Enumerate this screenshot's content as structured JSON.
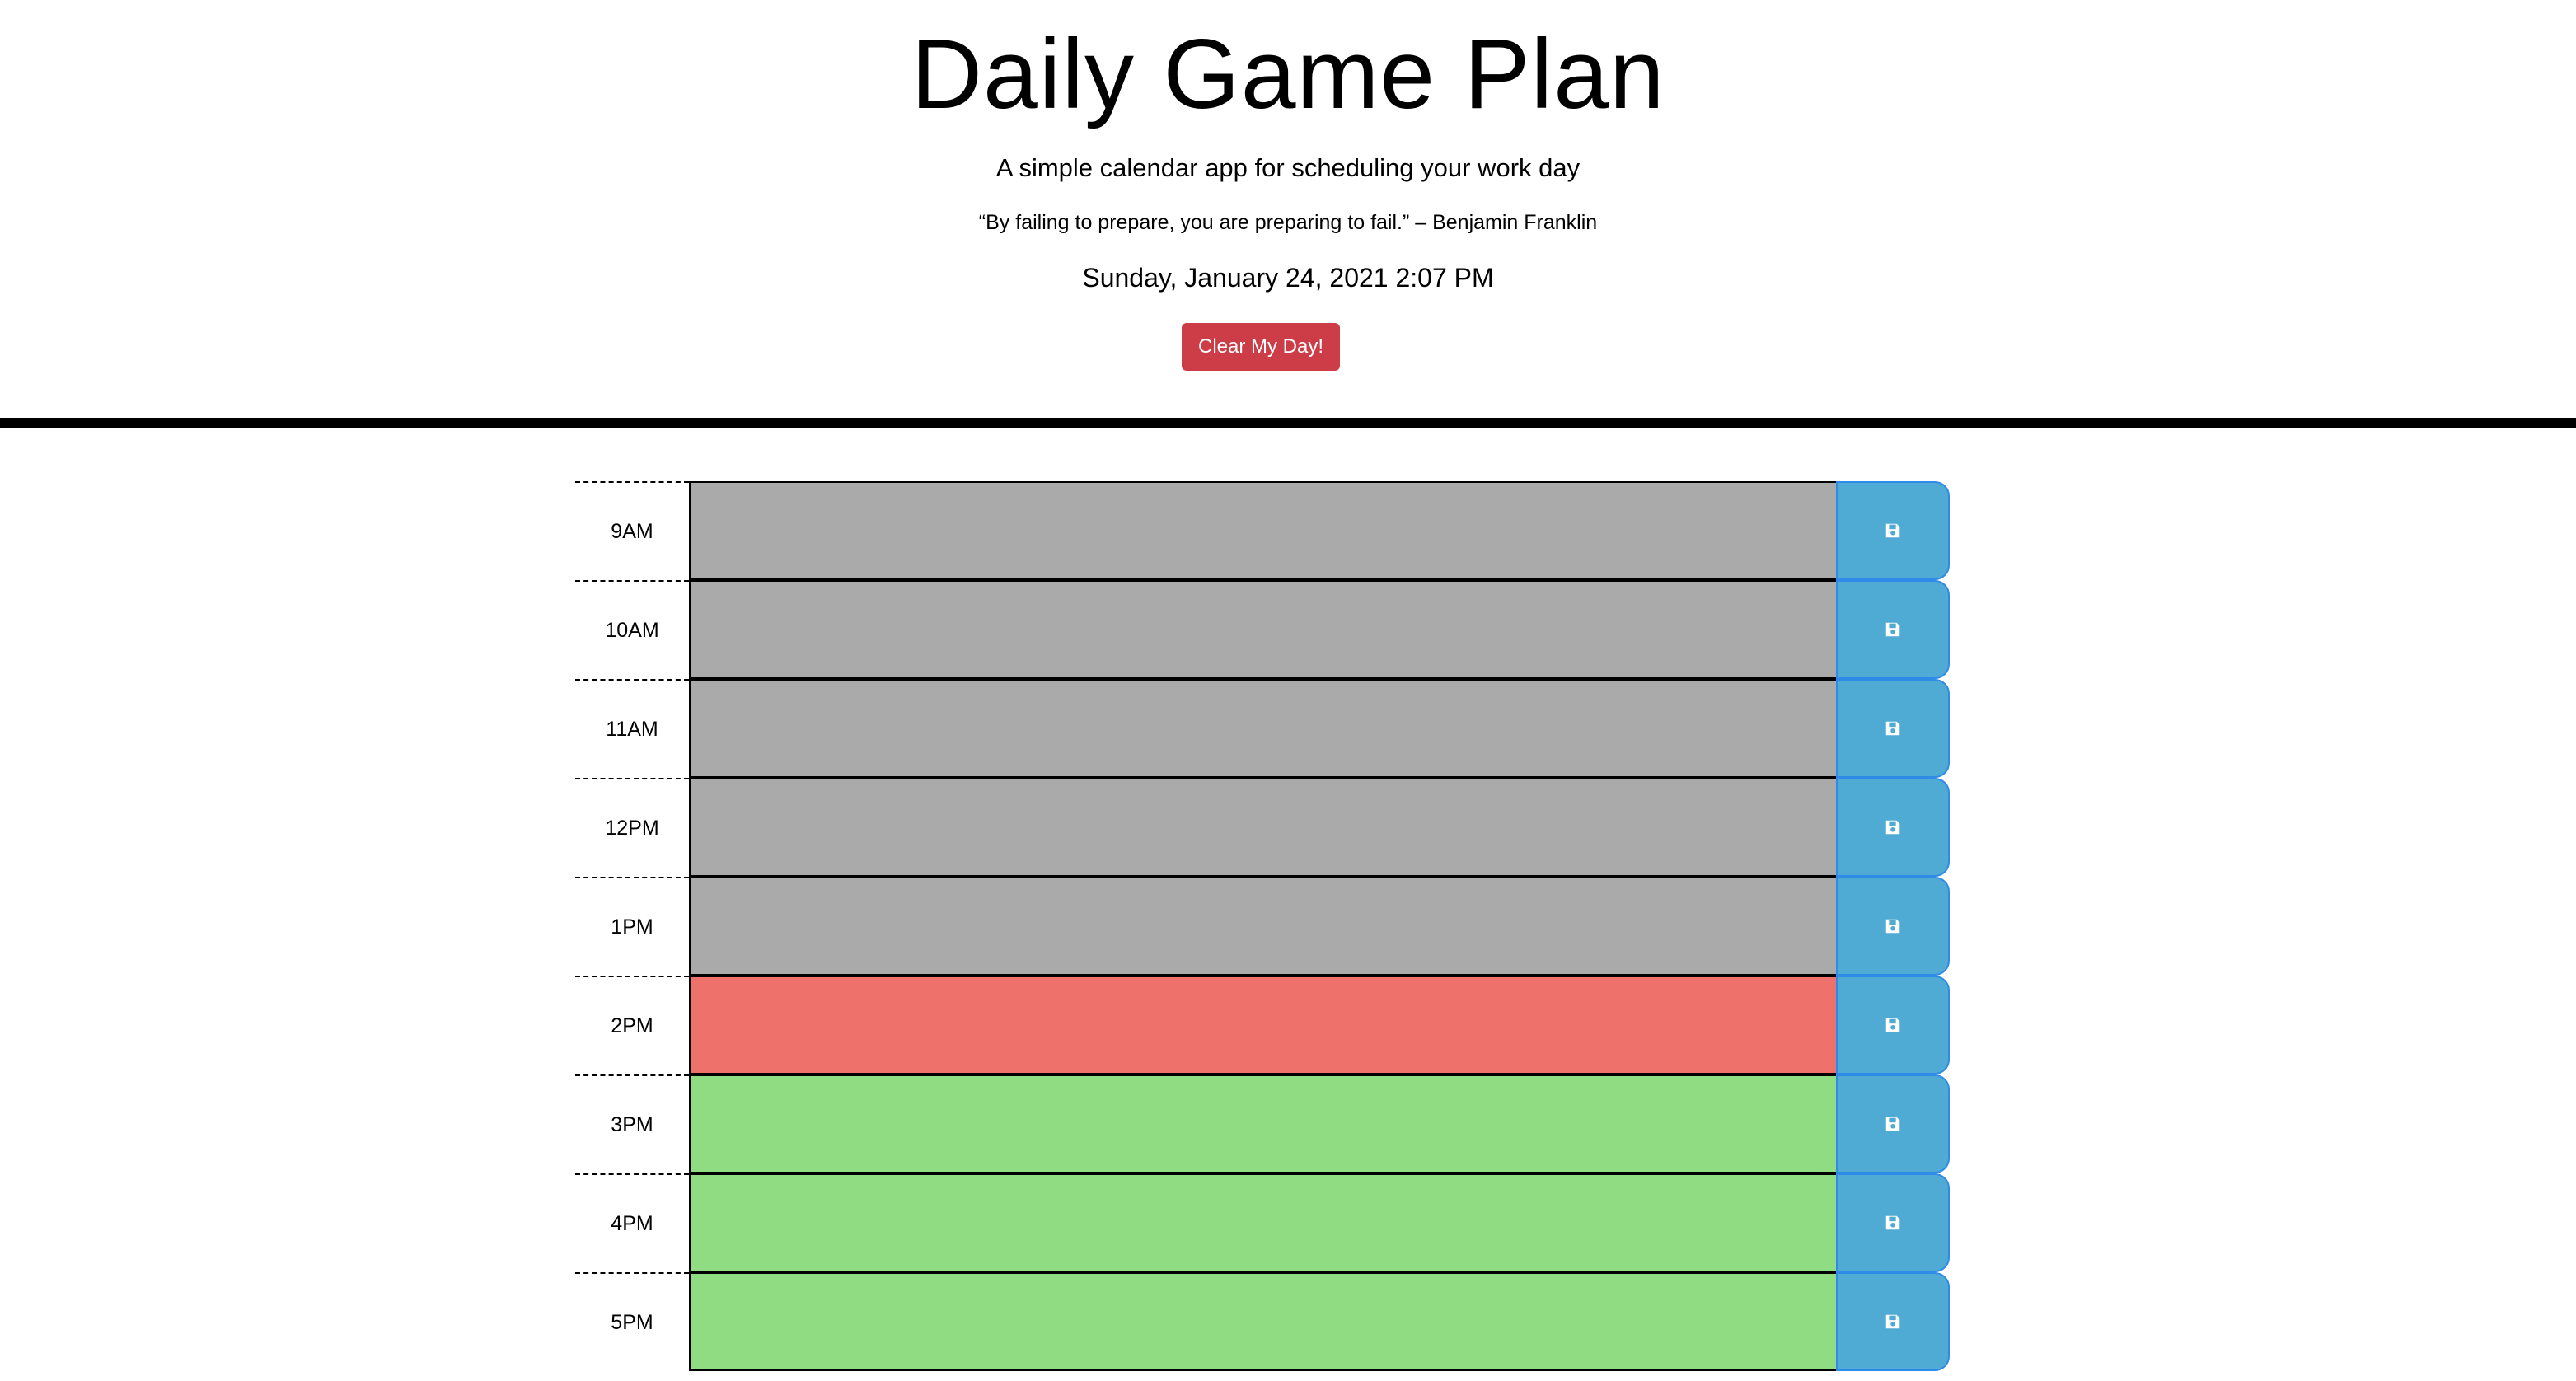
{
  "header": {
    "title": "Daily Game Plan",
    "subtitle": "A simple calendar app for scheduling your work day",
    "quote": "“By failing to prepare, you are preparing to fail.” – Benjamin Franklin",
    "datetime": "Sunday, January 24, 2021 2:07 PM",
    "clear_label": "Clear My Day!"
  },
  "colors": {
    "past": "#aaaaaa",
    "present": "#ee716b",
    "future": "#8fdc82",
    "save": "#4fabd4",
    "clear": "#cc3d47"
  },
  "schedule": [
    {
      "hour": "9AM",
      "status": "past",
      "text": "",
      "save_icon": "floppy-disk-icon"
    },
    {
      "hour": "10AM",
      "status": "past",
      "text": "",
      "save_icon": "floppy-disk-icon"
    },
    {
      "hour": "11AM",
      "status": "past",
      "text": "",
      "save_icon": "floppy-disk-icon"
    },
    {
      "hour": "12PM",
      "status": "past",
      "text": "",
      "save_icon": "floppy-disk-icon"
    },
    {
      "hour": "1PM",
      "status": "past",
      "text": "",
      "save_icon": "floppy-disk-icon"
    },
    {
      "hour": "2PM",
      "status": "present",
      "text": "",
      "save_icon": "floppy-disk-icon"
    },
    {
      "hour": "3PM",
      "status": "future",
      "text": "",
      "save_icon": "floppy-disk-icon"
    },
    {
      "hour": "4PM",
      "status": "future",
      "text": "",
      "save_icon": "floppy-disk-icon"
    },
    {
      "hour": "5PM",
      "status": "future",
      "text": "",
      "save_icon": "floppy-disk-icon"
    }
  ]
}
